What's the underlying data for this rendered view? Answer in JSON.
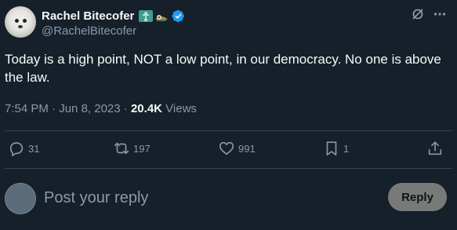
{
  "author": {
    "display_name": "Rachel Bitecofer",
    "handle": "@RachelBitecofer",
    "emojis": [
      "statue-of-liberty-emoji",
      "sloth-emoji"
    ],
    "verified": true
  },
  "tweet": {
    "text": "Today is a high point, NOT a low point, in our democracy. No one is above the law.",
    "time": "7:54 PM",
    "date": "Jun 8, 2023",
    "separator": "·",
    "views_count": "20.4K",
    "views_label": "Views"
  },
  "actions": {
    "replies": "31",
    "retweets": "197",
    "likes": "991",
    "bookmarks": "1"
  },
  "composer": {
    "placeholder": "Post your reply",
    "button_label": "Reply"
  },
  "colors": {
    "background": "#15202b",
    "text": "#f7f9f9",
    "secondary": "#8b98a5",
    "verified": "#1d9bf0",
    "divider": "#38444d"
  }
}
